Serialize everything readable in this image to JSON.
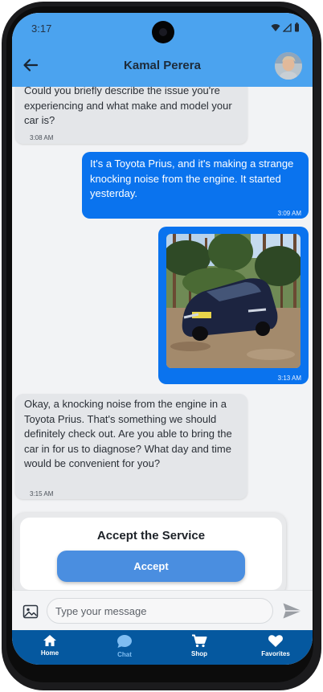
{
  "status_bar": {
    "time": "3:17"
  },
  "header": {
    "contact_name": "Kamal Perera",
    "back_icon": "arrow-left-icon",
    "avatar_icon": "user-avatar"
  },
  "messages": [
    {
      "direction": "incoming",
      "text": "Could you briefly describe the issue you're experiencing and what make and model your car is?",
      "time": "3:08 AM"
    },
    {
      "direction": "outgoing",
      "text": "It's a Toyota Prius, and it's making a strange knocking noise from the engine. It started yesterday.",
      "time": "3:09 AM"
    },
    {
      "direction": "outgoing",
      "type": "image",
      "image_alt": "dark blue Toyota Prius parked on gravel among pine trees",
      "plate": "SD58 YDM",
      "time": "3:13 AM"
    },
    {
      "direction": "incoming",
      "text": "Okay, a knocking noise from the engine in a Toyota Prius. That's something we should definitely check out. Are you able to bring the car in for us to diagnose? What day and time would be convenient for you?",
      "time": "3:15 AM"
    }
  ],
  "accept_card": {
    "title": "Accept the Service",
    "button_label": "Accept"
  },
  "composer": {
    "placeholder": "Type your message",
    "value": "",
    "image_icon": "image-icon",
    "send_icon": "send-icon"
  },
  "bottom_nav": {
    "items": [
      {
        "label": "Home",
        "icon": "home-icon",
        "active": false
      },
      {
        "label": "Chat",
        "icon": "chat-bubble-icon",
        "active": true
      },
      {
        "label": "Shop",
        "icon": "shopping-cart-icon",
        "active": false
      },
      {
        "label": "Favorites",
        "icon": "heart-icon",
        "active": false
      }
    ]
  },
  "colors": {
    "header": "#4ba3ef",
    "outgoing_bubble": "#0a73ee",
    "incoming_bubble": "#e4e6e9",
    "accept_button": "#4a8ee0",
    "bottom_nav": "#05589f",
    "active_nav": "#7fbdf2"
  }
}
